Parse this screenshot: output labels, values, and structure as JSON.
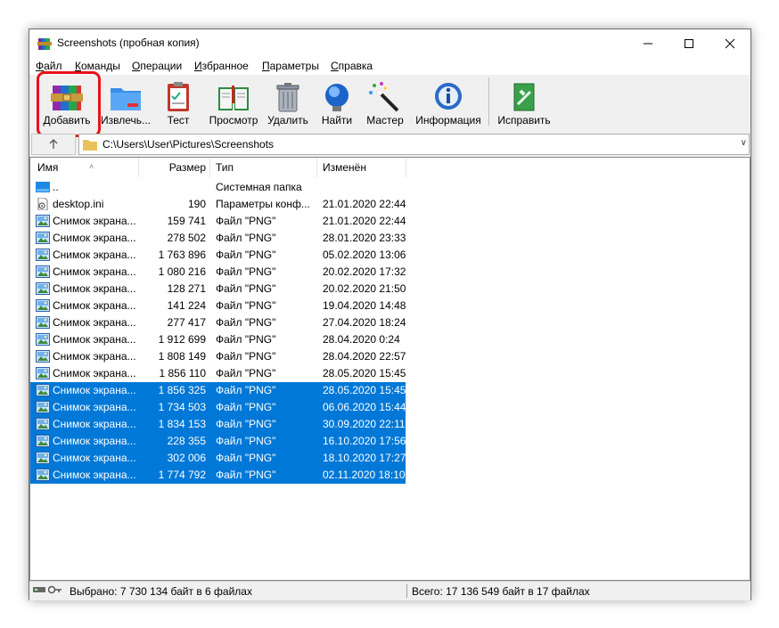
{
  "window": {
    "title": "Screenshots (пробная копия)"
  },
  "menu": [
    {
      "u": "Ф",
      "rest": "айл"
    },
    {
      "u": "К",
      "rest": "оманды"
    },
    {
      "u": "О",
      "rest": "перации"
    },
    {
      "u": "И",
      "rest": "збранное"
    },
    {
      "u": "П",
      "rest": "араметры"
    },
    {
      "u": "С",
      "rest": "правка"
    }
  ],
  "toolbar": [
    {
      "label": "Добавить",
      "icon": "archive-add-icon"
    },
    {
      "label": "Извлечь...",
      "icon": "folder-extract-icon"
    },
    {
      "label": "Тест",
      "icon": "clipboard-test-icon"
    },
    {
      "label": "Просмотр",
      "icon": "book-view-icon"
    },
    {
      "label": "Удалить",
      "icon": "trash-icon"
    },
    {
      "label": "Найти",
      "icon": "magnifier-icon"
    },
    {
      "label": "Мастер",
      "icon": "wizard-wand-icon"
    },
    {
      "label": "Информация",
      "icon": "info-icon"
    },
    {
      "label": "Исправить",
      "icon": "repair-icon"
    }
  ],
  "address": {
    "path": "C:\\Users\\User\\Pictures\\Screenshots"
  },
  "columns": [
    "Имя",
    "Размер",
    "Тип",
    "Изменён"
  ],
  "files": [
    {
      "name": "..",
      "size": "",
      "type": "Системная папка",
      "modified": "",
      "icon": "parent-folder-icon",
      "selected": false
    },
    {
      "name": "desktop.ini",
      "size": "190",
      "type": "Параметры конф...",
      "modified": "21.01.2020 22:44",
      "icon": "settings-file-icon",
      "selected": false
    },
    {
      "name": "Снимок экрана...",
      "size": "159 741",
      "type": "Файл \"PNG\"",
      "modified": "21.01.2020 22:44",
      "icon": "image-file-icon",
      "selected": false
    },
    {
      "name": "Снимок экрана...",
      "size": "278 502",
      "type": "Файл \"PNG\"",
      "modified": "28.01.2020 23:33",
      "icon": "image-file-icon",
      "selected": false
    },
    {
      "name": "Снимок экрана...",
      "size": "1 763 896",
      "type": "Файл \"PNG\"",
      "modified": "05.02.2020 13:06",
      "icon": "image-file-icon",
      "selected": false
    },
    {
      "name": "Снимок экрана...",
      "size": "1 080 216",
      "type": "Файл \"PNG\"",
      "modified": "20.02.2020 17:32",
      "icon": "image-file-icon",
      "selected": false
    },
    {
      "name": "Снимок экрана...",
      "size": "128 271",
      "type": "Файл \"PNG\"",
      "modified": "20.02.2020 21:50",
      "icon": "image-file-icon",
      "selected": false
    },
    {
      "name": "Снимок экрана...",
      "size": "141 224",
      "type": "Файл \"PNG\"",
      "modified": "19.04.2020 14:48",
      "icon": "image-file-icon",
      "selected": false
    },
    {
      "name": "Снимок экрана...",
      "size": "277 417",
      "type": "Файл \"PNG\"",
      "modified": "27.04.2020 18:24",
      "icon": "image-file-icon",
      "selected": false
    },
    {
      "name": "Снимок экрана...",
      "size": "1 912 699",
      "type": "Файл \"PNG\"",
      "modified": "28.04.2020 0:24",
      "icon": "image-file-icon",
      "selected": false
    },
    {
      "name": "Снимок экрана...",
      "size": "1 808 149",
      "type": "Файл \"PNG\"",
      "modified": "28.04.2020 22:57",
      "icon": "image-file-icon",
      "selected": false
    },
    {
      "name": "Снимок экрана...",
      "size": "1 856 110",
      "type": "Файл \"PNG\"",
      "modified": "28.05.2020 15:45",
      "icon": "image-file-icon",
      "selected": false
    },
    {
      "name": "Снимок экрана...",
      "size": "1 856 325",
      "type": "Файл \"PNG\"",
      "modified": "28.05.2020 15:45",
      "icon": "image-file-icon",
      "selected": true
    },
    {
      "name": "Снимок экрана...",
      "size": "1 734 503",
      "type": "Файл \"PNG\"",
      "modified": "06.06.2020 15:44",
      "icon": "image-file-icon",
      "selected": true
    },
    {
      "name": "Снимок экрана...",
      "size": "1 834 153",
      "type": "Файл \"PNG\"",
      "modified": "30.09.2020 22:11",
      "icon": "image-file-icon",
      "selected": true
    },
    {
      "name": "Снимок экрана...",
      "size": "228 355",
      "type": "Файл \"PNG\"",
      "modified": "16.10.2020 17:56",
      "icon": "image-file-icon",
      "selected": true
    },
    {
      "name": "Снимок экрана...",
      "size": "302 006",
      "type": "Файл \"PNG\"",
      "modified": "18.10.2020 17:27",
      "icon": "image-file-icon",
      "selected": true
    },
    {
      "name": "Снимок экрана...",
      "size": "1 774 792",
      "type": "Файл \"PNG\"",
      "modified": "02.11.2020 18:10",
      "icon": "image-file-icon",
      "selected": true
    }
  ],
  "status": {
    "selected": "Выбрано: 7 730 134 байт в 6 файлах",
    "total": "Всего: 17 136 549 байт в 17 файлах"
  },
  "colors": {
    "selection": "#0078d7",
    "highlight": "#e8121a"
  }
}
